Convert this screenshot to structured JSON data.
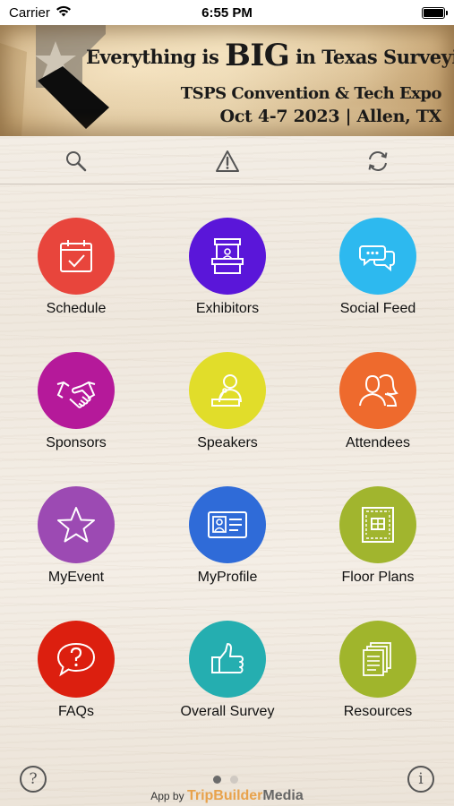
{
  "status_bar": {
    "carrier": "Carrier",
    "time": "6:55 PM"
  },
  "banner": {
    "title_pre": "Everything is ",
    "title_big": "BIG",
    "title_post": " in Texas Surveying!",
    "subtitle": "TSPS Convention & Tech Expo",
    "dates": "Oct 4-7 2023 | Allen, TX"
  },
  "toolbar": {
    "icons": [
      "search-icon",
      "alert-icon",
      "refresh-icon"
    ]
  },
  "tiles": [
    {
      "label": "Schedule",
      "color": "#e8453c",
      "icon": "calendar-icon"
    },
    {
      "label": "Exhibitors",
      "color": "#5a16d9",
      "icon": "booth-icon"
    },
    {
      "label": "Social Feed",
      "color": "#2db9ef",
      "icon": "chat-bubbles-icon"
    },
    {
      "label": "Sponsors",
      "color": "#b5199a",
      "icon": "handshake-icon"
    },
    {
      "label": "Speakers",
      "color": "#e1dd2a",
      "icon": "speaker-icon"
    },
    {
      "label": "Attendees",
      "color": "#ee6a2d",
      "icon": "people-icon"
    },
    {
      "label": "MyEvent",
      "color": "#9c4ab3",
      "icon": "star-icon"
    },
    {
      "label": "MyProfile",
      "color": "#2f6bd8",
      "icon": "id-card-icon"
    },
    {
      "label": "Floor Plans",
      "color": "#a1b52e",
      "icon": "floor-plan-icon"
    },
    {
      "label": "FAQs",
      "color": "#dc1f0f",
      "icon": "question-bubble-icon"
    },
    {
      "label": "Overall Survey",
      "color": "#25aeb0",
      "icon": "thumbs-up-icon"
    },
    {
      "label": "Resources",
      "color": "#a0b52c",
      "icon": "documents-icon"
    }
  ],
  "footer": {
    "help": "?",
    "info": "i",
    "powered_prefix": "App by ",
    "brand_a": "TripBuilder",
    "brand_b": "Media",
    "pages": 2,
    "current_page": 1
  }
}
